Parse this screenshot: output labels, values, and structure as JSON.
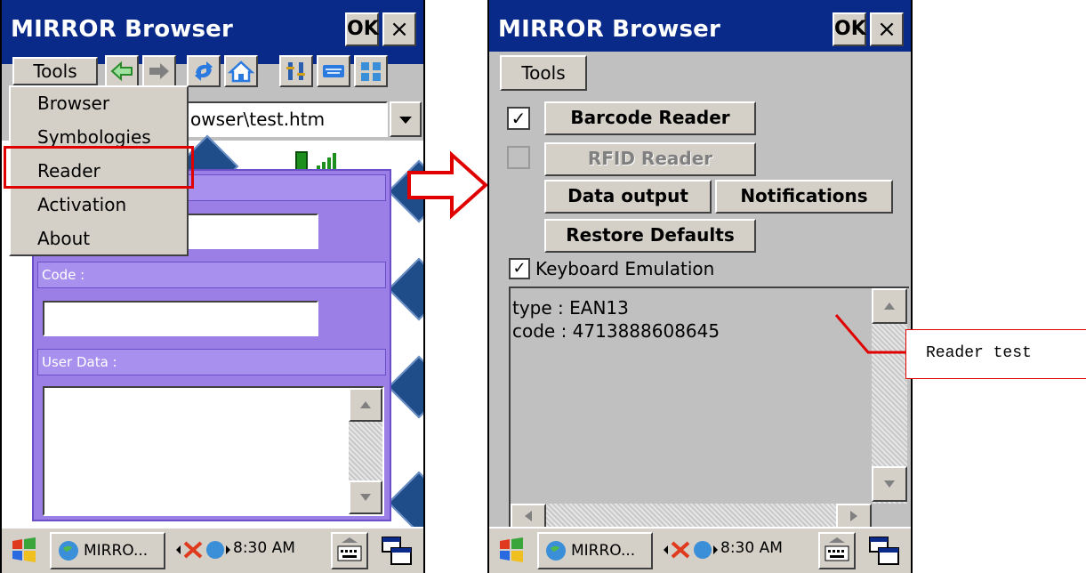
{
  "left": {
    "title": "MIRROR Browser",
    "ok_label": "OK",
    "close_label": "×",
    "tools_label": "Tools",
    "address": "owser\\test.htm",
    "menu": [
      "Browser",
      "Symbologies",
      "Reader",
      "Activation",
      "About"
    ],
    "code_label": "Code :",
    "user_data_label": "User Data :",
    "taskbar_app": "MIRRO...",
    "clock": "8:30 AM"
  },
  "right": {
    "title": "MIRROR Browser",
    "ok_label": "OK",
    "close_label": "×",
    "tools_label": "Tools",
    "barcode_reader": "Barcode Reader",
    "barcode_checked": true,
    "rfid_reader": "RFID Reader",
    "rfid_checked": false,
    "data_output": "Data output",
    "notifications": "Notifications",
    "restore_defaults": "Restore Defaults",
    "keyboard_emulation": "Keyboard Emulation",
    "keyboard_checked": true,
    "output_lines": [
      "type : EAN13",
      "code : 4713888608645"
    ],
    "taskbar_app": "MIRRO...",
    "clock": "8:30 AM"
  },
  "callout": {
    "label": "Reader test"
  },
  "colors": {
    "titlebar": "#0a2a8a",
    "highlight": "#e00000",
    "purple": "#9b7fe6"
  }
}
